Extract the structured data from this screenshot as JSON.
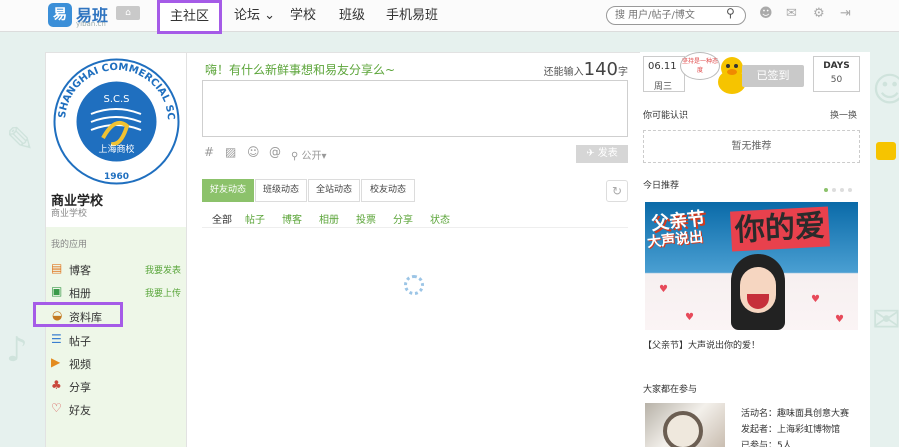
{
  "header": {
    "logo_mark": "易",
    "logo_name": "易班",
    "logo_sub": "yiban.cn",
    "home_badge": "⌂",
    "nav": [
      {
        "label": "主社区",
        "active": true
      },
      {
        "label": "论坛 ⌄"
      },
      {
        "label": "学校"
      },
      {
        "label": "班级"
      },
      {
        "label": "手机易班"
      }
    ],
    "search_placeholder": "搜 用户/帖子/博文",
    "icons": [
      "search-icon",
      "user-icon",
      "mail-icon",
      "gear-icon",
      "logout-icon"
    ]
  },
  "profile": {
    "name": "商业学校",
    "sub": "商业学校",
    "logo_text_top": "SHANGHAI COMMERCIAL SCHOOL",
    "logo_initials": "S.C.S",
    "logo_chinese": "上海商校",
    "logo_year": "1960"
  },
  "apps": {
    "title": "我的应用",
    "items": [
      {
        "label": "博客",
        "icon": "blog-icon",
        "glyph": "▤",
        "action": "我要发表",
        "color": "#e07b26"
      },
      {
        "label": "相册",
        "icon": "photo-icon",
        "glyph": "▣",
        "action": "我要上传",
        "color": "#3a9a4a"
      },
      {
        "label": "资料库",
        "icon": "library-icon",
        "glyph": "◒",
        "action": "",
        "color": "#c47a22"
      },
      {
        "label": "帖子",
        "icon": "post-icon",
        "glyph": "☰",
        "action": "",
        "color": "#3b7fd0"
      },
      {
        "label": "视频",
        "icon": "video-icon",
        "glyph": "▶",
        "action": "",
        "color": "#e38b1f"
      },
      {
        "label": "分享",
        "icon": "share-icon",
        "glyph": "♣",
        "action": "",
        "color": "#c9473b"
      },
      {
        "label": "好友",
        "icon": "friend-icon",
        "glyph": "♡",
        "action": "",
        "color": "#d33a3a"
      }
    ]
  },
  "composer": {
    "prompt": "嗨！有什么新鲜事想和易友分享么~",
    "remaining_prefix": "还能输入",
    "remaining_count": "140",
    "remaining_suffix": "字",
    "tools": [
      "#",
      "▨",
      "☺",
      "@",
      "⚲ 公开▾"
    ],
    "publish": "✈ 发表"
  },
  "feed": {
    "tabs": [
      {
        "label": "好友动态",
        "active": true
      },
      {
        "label": "班级动态"
      },
      {
        "label": "全站动态"
      },
      {
        "label": "校友动态"
      }
    ],
    "refresh": "↻",
    "filters": [
      {
        "label": "全部",
        "active": true
      },
      {
        "label": "帖子"
      },
      {
        "label": "博客"
      },
      {
        "label": "相册"
      },
      {
        "label": "投票"
      },
      {
        "label": "分享"
      },
      {
        "label": "状态"
      }
    ]
  },
  "checkin": {
    "date": "06.11",
    "weekday": "周三",
    "bubble": "坚持是一种态度",
    "button": "已签到",
    "days_label": "DAYS",
    "days_count": "50"
  },
  "suggest": {
    "title": "你可能认识",
    "link": "换一换",
    "empty": "暂无推荐"
  },
  "recommend": {
    "title": "今日推荐",
    "banner_line1": "父亲节",
    "banner_line2": "大声说出",
    "banner_line3": "你的爱",
    "caption": "【父亲节】大声说出你的爱！"
  },
  "participating": {
    "title": "大家都在参与",
    "event_name": "活动名：趣味面具创意大赛",
    "organizer": "发起者：上海彩虹博物馆",
    "count": "已参与：5人"
  }
}
